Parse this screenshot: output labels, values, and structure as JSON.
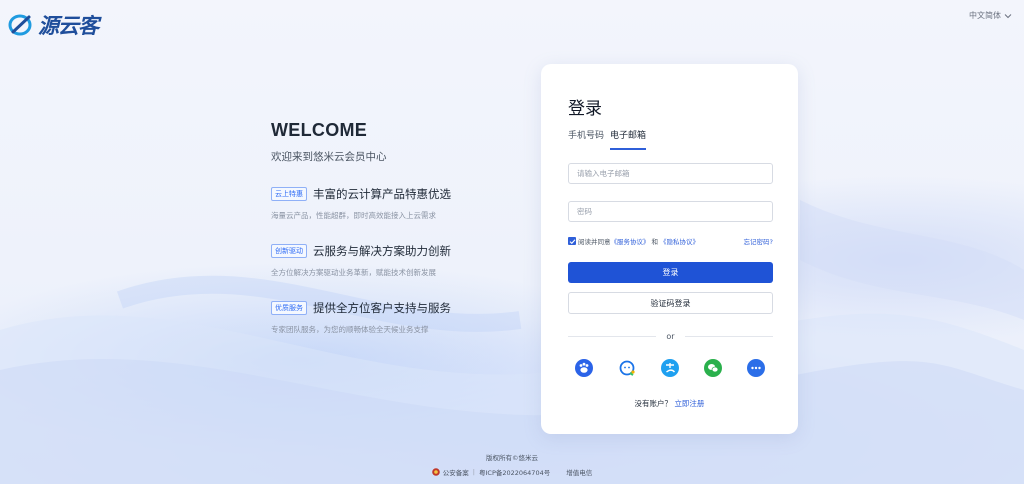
{
  "brand": {
    "logo_text": "源云客"
  },
  "header": {
    "language": "中文简体"
  },
  "intro": {
    "welcome": "WELCOME",
    "subtitle": "欢迎来到悠米云会员中心",
    "features": [
      {
        "tag": "云上特惠",
        "title": "丰富的云计算产品特惠优选",
        "desc": "海量云产品，性能超群，即时高效能接入上云需求"
      },
      {
        "tag": "创新驱动",
        "title": "云服务与解决方案助力创新",
        "desc": "全方位解决方案驱动业务革新，赋能技术创新发展"
      },
      {
        "tag": "优质服务",
        "title": "提供全方位客户支持与服务",
        "desc": "专家团队服务，为您的顺畅体验全天候业务支撑"
      }
    ]
  },
  "login": {
    "title": "登录",
    "tabs": [
      {
        "label": "手机号码"
      },
      {
        "label": "电子邮箱"
      }
    ],
    "active_tab": 1,
    "email_placeholder": "请输入电子邮箱",
    "password_placeholder": "密码",
    "agree_prefix": "阅读并同意",
    "service_agreement": "《服务协议》",
    "and": "和",
    "privacy_policy": "《隐私协议》",
    "forgot_password": "忘记密码?",
    "login_button": "登录",
    "code_login_button": "验证码登录",
    "or": "or",
    "no_account": "没有账户？",
    "register_now": "立即注册",
    "social_icons": [
      "baidu-icon",
      "qq-icon",
      "alipay-icon",
      "wechat-icon",
      "more-icon"
    ]
  },
  "footer": {
    "copyright": "版权所有©悠米云",
    "police_record": "公安备案",
    "icp": "粤ICP备2022064704号",
    "telecom": "增值电信"
  },
  "colors": {
    "primary": "#1f53d6",
    "link": "#2f5fd9",
    "brand": "#1f4e9b"
  }
}
